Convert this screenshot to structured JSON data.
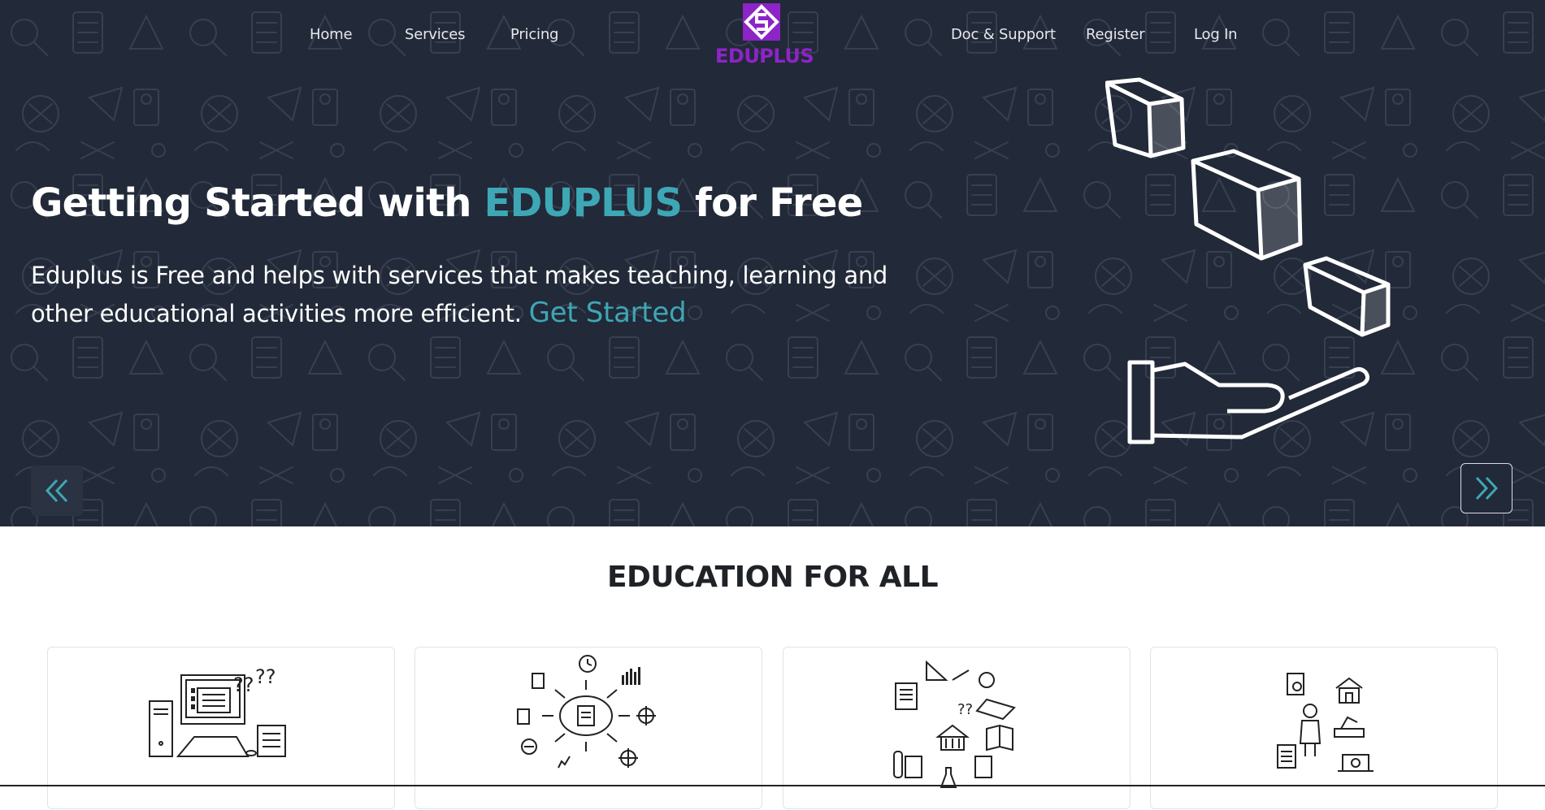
{
  "nav": {
    "home": "Home",
    "services": "Services",
    "pricing": "Pricing",
    "doc_support": "Doc & Support",
    "register": "Register",
    "login": "Log In"
  },
  "logo": {
    "text": "EDUPLUS",
    "color": "#8d24c7"
  },
  "hero": {
    "title_before": "Getting Started with ",
    "title_accent": "EDUPLUS",
    "title_after": " for Free",
    "description": "Eduplus is Free and helps with services that makes teaching, learning and other educational activities more efficient. ",
    "cta": "Get Started",
    "accent_color": "#3ea7b5",
    "background_color": "#222938"
  },
  "carousel": {
    "prev_icon": "double-chevron-left-icon",
    "next_icon": "double-chevron-right-icon"
  },
  "section": {
    "title": "EDUCATION FOR ALL"
  },
  "cards": [
    {
      "icon": "computer-questions-icon"
    },
    {
      "icon": "learning-hub-icon"
    },
    {
      "icon": "education-resources-icon"
    },
    {
      "icon": "student-services-icon"
    }
  ]
}
